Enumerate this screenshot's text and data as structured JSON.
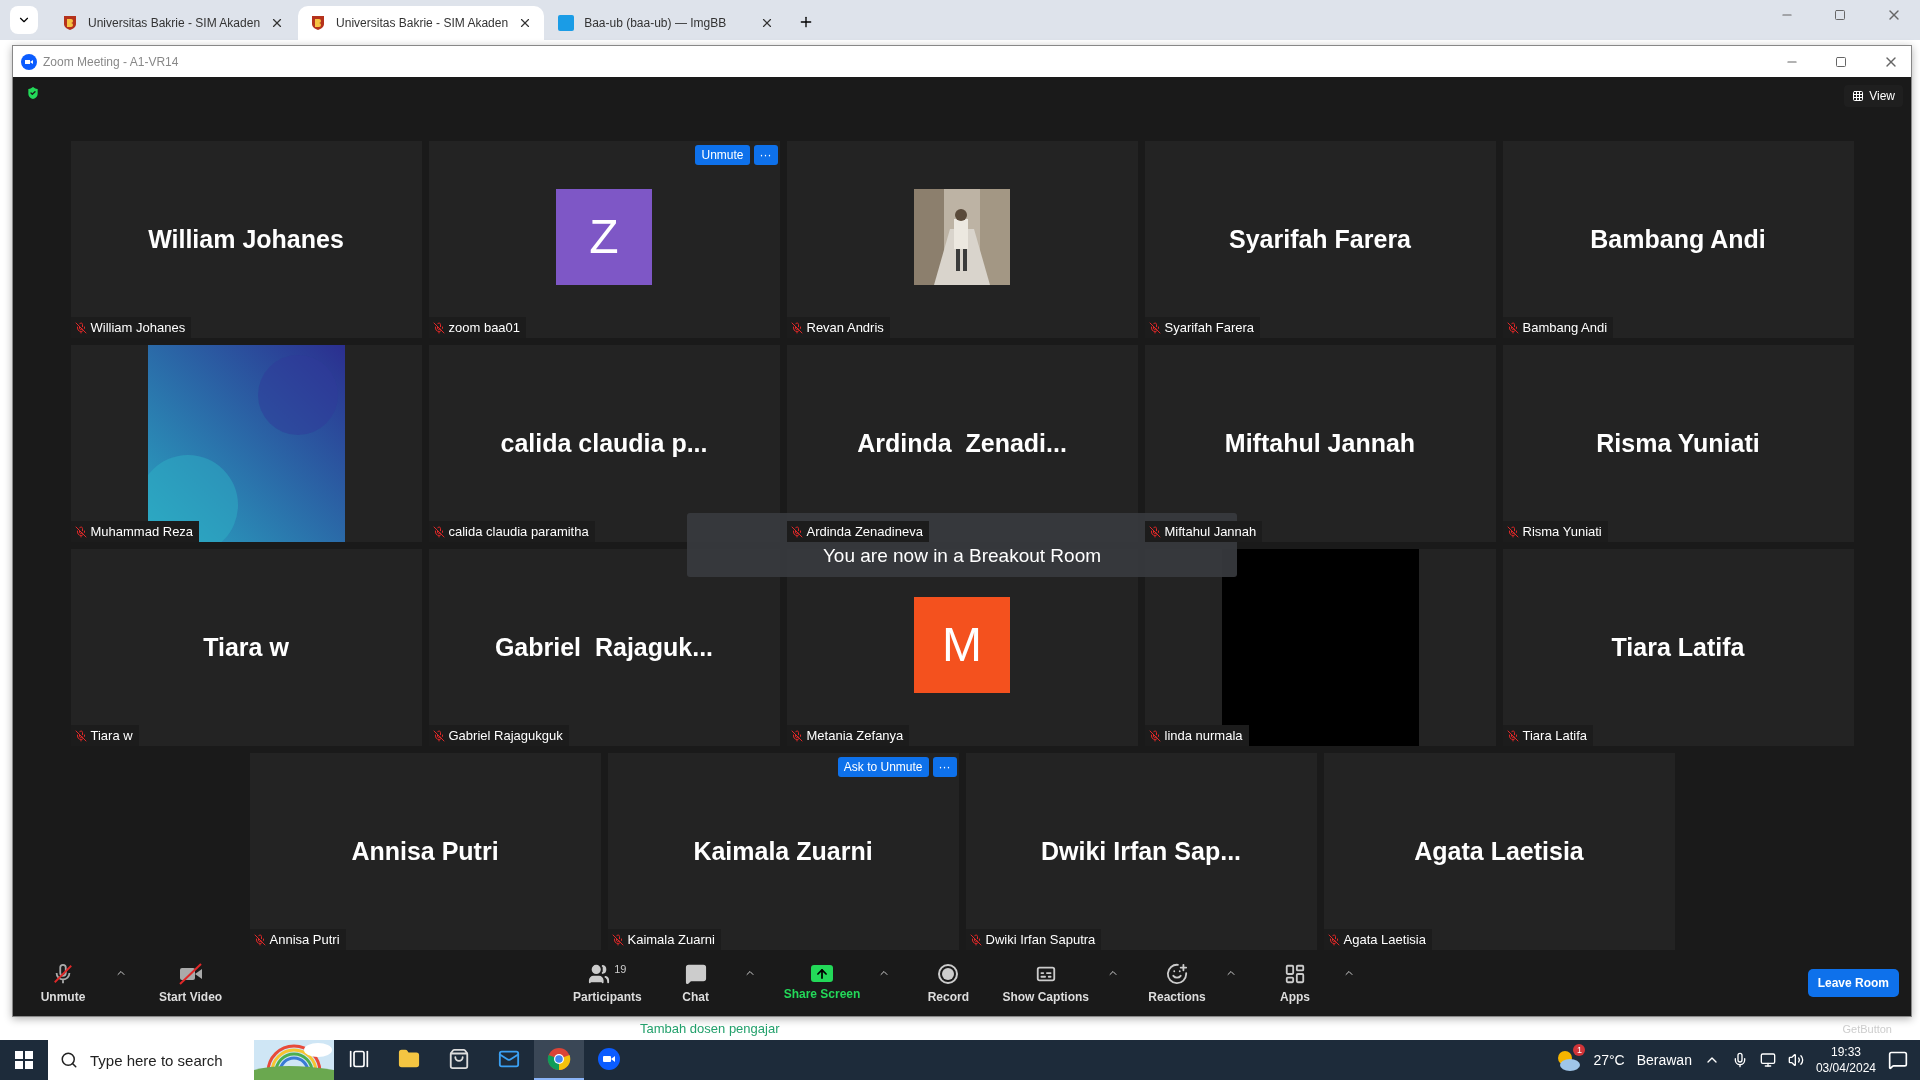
{
  "browser": {
    "tabs": [
      {
        "title": "Universitas Bakrie - SIM Akaden",
        "kind": "shield",
        "selected": false
      },
      {
        "title": "Universitas Bakrie - SIM Akaden",
        "kind": "shield",
        "selected": true
      },
      {
        "title": "Baa-ub (baa-ub) — ImgBB",
        "kind": "square",
        "selected": false
      }
    ]
  },
  "window": {
    "title": "Zoom Meeting - A1-VR14"
  },
  "top_bar": {
    "view_button": "View"
  },
  "tile_rows": [
    {
      "tiles": [
        {
          "kind": "name",
          "display": "William Johanes",
          "label": "William Johanes",
          "muted": true
        },
        {
          "kind": "avatar",
          "letter": "Z",
          "color": "#7e57c6",
          "label": "zoom baa01",
          "muted": true,
          "actions": {
            "button": "Unmute",
            "more": "···"
          }
        },
        {
          "label": "Revan Andris",
          "muted": true
        },
        {
          "kind": "name",
          "display": "Syarifah Farera",
          "label": "Syarifah Farera",
          "muted": true
        },
        {
          "kind": "name",
          "display": "Bambang Andi",
          "label": "Bambang Andi",
          "muted": true
        }
      ]
    },
    {
      "tiles": [
        {
          "kind": "gradient",
          "label": "Muhammad Reza",
          "muted": true
        },
        {
          "kind": "name",
          "display": "calida claudia p...",
          "label": "calida claudia paramitha",
          "muted": true
        },
        {
          "kind": "name",
          "display": "Ardinda  Zenadi...",
          "label": "Ardinda Zenadineva",
          "muted": true
        },
        {
          "kind": "name",
          "display": "Miftahul Jannah",
          "label": "Miftahul Jannah",
          "muted": true
        },
        {
          "kind": "name",
          "display": "Risma Yuniati",
          "label": "Risma Yuniati",
          "muted": true
        }
      ]
    },
    {
      "tiles": [
        {
          "kind": "name",
          "display": "Tiara w",
          "label": "Tiara w",
          "muted": true
        },
        {
          "kind": "name",
          "display": "Gabriel  Rajaguk...",
          "label": "Gabriel Rajagukguk",
          "muted": true
        },
        {
          "kind": "avatar",
          "letter": "M",
          "color": "#f4511e",
          "label": "Metania Zefanya",
          "muted": true
        },
        {
          "kind": "video",
          "label": "linda nurmala",
          "muted": true
        },
        {
          "kind": "name",
          "display": "Tiara Latifa",
          "label": "Tiara Latifa",
          "muted": true
        }
      ]
    },
    {
      "tiles": [
        {
          "kind": "name",
          "display": "Annisa Putri",
          "label": "Annisa Putri",
          "muted": true
        },
        {
          "kind": "name",
          "display": "Kaimala Zuarni",
          "label": "Kaimala Zuarni",
          "muted": true,
          "actions": {
            "button": "Ask to Unmute",
            "more": "···"
          }
        },
        {
          "kind": "name",
          "display": "Dwiki Irfan Sap...",
          "label": "Dwiki Irfan Saputra",
          "muted": true
        },
        {
          "kind": "name",
          "display": "Agata Laetisia",
          "label": "Agata Laetisia",
          "muted": true
        }
      ]
    }
  ],
  "toast": "You are now in a Breakout Room",
  "toolbar": {
    "left": [
      {
        "kind": "mic",
        "label": "Unmute",
        "caret": true
      },
      {
        "kind": "video",
        "label": "Start Video",
        "caret": false
      }
    ],
    "center": [
      {
        "kind": "participants",
        "label": "Participants",
        "count": "19",
        "caret": false
      },
      {
        "kind": "chat",
        "label": "Chat",
        "caret": true
      },
      {
        "kind": "share",
        "label": "Share Screen",
        "caret": true
      },
      {
        "kind": "record",
        "label": "Record",
        "caret": false
      },
      {
        "kind": "captions",
        "label": "Show Captions",
        "caret": true
      },
      {
        "kind": "reactions",
        "label": "Reactions",
        "caret": true
      },
      {
        "kind": "apps",
        "label": "Apps",
        "caret": true
      }
    ],
    "leave": "Leave Room"
  },
  "page_behind": {
    "link": "Tambah dosen pengajar",
    "badge": "GetButton"
  },
  "taskbar": {
    "search": {
      "placeholder": "Type here to search"
    },
    "apps": [
      {
        "kind": "taskview",
        "selected": false
      },
      {
        "kind": "explorer",
        "selected": false
      },
      {
        "kind": "store",
        "selected": false
      },
      {
        "kind": "mail",
        "selected": false
      },
      {
        "kind": "chrome",
        "selected": true
      },
      {
        "kind": "zoom",
        "selected": false
      }
    ],
    "weather": {
      "badge": "1",
      "temperature": "27°C",
      "condition": "Berawan"
    },
    "time": "19:33",
    "date": "03/04/2024"
  }
}
